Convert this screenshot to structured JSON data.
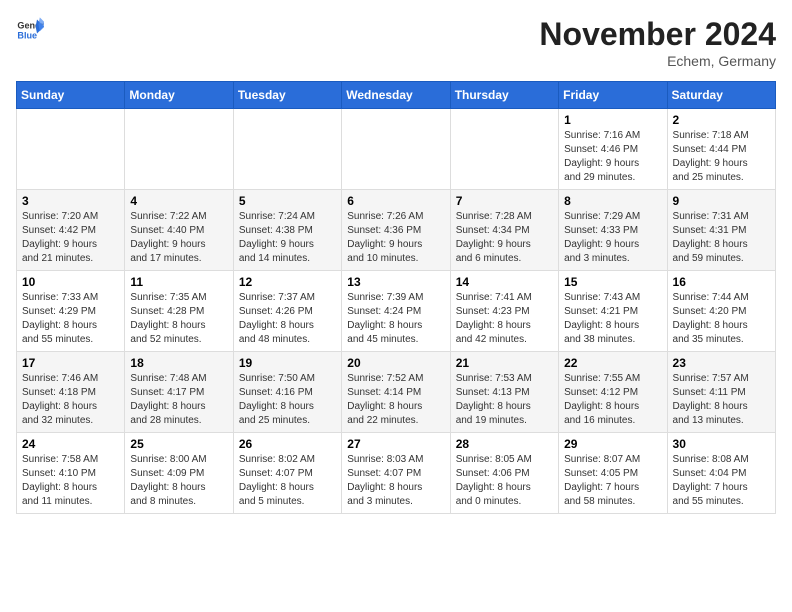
{
  "header": {
    "logo_general": "General",
    "logo_blue": "Blue",
    "month_title": "November 2024",
    "location": "Echem, Germany"
  },
  "weekdays": [
    "Sunday",
    "Monday",
    "Tuesday",
    "Wednesday",
    "Thursday",
    "Friday",
    "Saturday"
  ],
  "weeks": [
    [
      {
        "day": "",
        "info": ""
      },
      {
        "day": "",
        "info": ""
      },
      {
        "day": "",
        "info": ""
      },
      {
        "day": "",
        "info": ""
      },
      {
        "day": "",
        "info": ""
      },
      {
        "day": "1",
        "info": "Sunrise: 7:16 AM\nSunset: 4:46 PM\nDaylight: 9 hours\nand 29 minutes."
      },
      {
        "day": "2",
        "info": "Sunrise: 7:18 AM\nSunset: 4:44 PM\nDaylight: 9 hours\nand 25 minutes."
      }
    ],
    [
      {
        "day": "3",
        "info": "Sunrise: 7:20 AM\nSunset: 4:42 PM\nDaylight: 9 hours\nand 21 minutes."
      },
      {
        "day": "4",
        "info": "Sunrise: 7:22 AM\nSunset: 4:40 PM\nDaylight: 9 hours\nand 17 minutes."
      },
      {
        "day": "5",
        "info": "Sunrise: 7:24 AM\nSunset: 4:38 PM\nDaylight: 9 hours\nand 14 minutes."
      },
      {
        "day": "6",
        "info": "Sunrise: 7:26 AM\nSunset: 4:36 PM\nDaylight: 9 hours\nand 10 minutes."
      },
      {
        "day": "7",
        "info": "Sunrise: 7:28 AM\nSunset: 4:34 PM\nDaylight: 9 hours\nand 6 minutes."
      },
      {
        "day": "8",
        "info": "Sunrise: 7:29 AM\nSunset: 4:33 PM\nDaylight: 9 hours\nand 3 minutes."
      },
      {
        "day": "9",
        "info": "Sunrise: 7:31 AM\nSunset: 4:31 PM\nDaylight: 8 hours\nand 59 minutes."
      }
    ],
    [
      {
        "day": "10",
        "info": "Sunrise: 7:33 AM\nSunset: 4:29 PM\nDaylight: 8 hours\nand 55 minutes."
      },
      {
        "day": "11",
        "info": "Sunrise: 7:35 AM\nSunset: 4:28 PM\nDaylight: 8 hours\nand 52 minutes."
      },
      {
        "day": "12",
        "info": "Sunrise: 7:37 AM\nSunset: 4:26 PM\nDaylight: 8 hours\nand 48 minutes."
      },
      {
        "day": "13",
        "info": "Sunrise: 7:39 AM\nSunset: 4:24 PM\nDaylight: 8 hours\nand 45 minutes."
      },
      {
        "day": "14",
        "info": "Sunrise: 7:41 AM\nSunset: 4:23 PM\nDaylight: 8 hours\nand 42 minutes."
      },
      {
        "day": "15",
        "info": "Sunrise: 7:43 AM\nSunset: 4:21 PM\nDaylight: 8 hours\nand 38 minutes."
      },
      {
        "day": "16",
        "info": "Sunrise: 7:44 AM\nSunset: 4:20 PM\nDaylight: 8 hours\nand 35 minutes."
      }
    ],
    [
      {
        "day": "17",
        "info": "Sunrise: 7:46 AM\nSunset: 4:18 PM\nDaylight: 8 hours\nand 32 minutes."
      },
      {
        "day": "18",
        "info": "Sunrise: 7:48 AM\nSunset: 4:17 PM\nDaylight: 8 hours\nand 28 minutes."
      },
      {
        "day": "19",
        "info": "Sunrise: 7:50 AM\nSunset: 4:16 PM\nDaylight: 8 hours\nand 25 minutes."
      },
      {
        "day": "20",
        "info": "Sunrise: 7:52 AM\nSunset: 4:14 PM\nDaylight: 8 hours\nand 22 minutes."
      },
      {
        "day": "21",
        "info": "Sunrise: 7:53 AM\nSunset: 4:13 PM\nDaylight: 8 hours\nand 19 minutes."
      },
      {
        "day": "22",
        "info": "Sunrise: 7:55 AM\nSunset: 4:12 PM\nDaylight: 8 hours\nand 16 minutes."
      },
      {
        "day": "23",
        "info": "Sunrise: 7:57 AM\nSunset: 4:11 PM\nDaylight: 8 hours\nand 13 minutes."
      }
    ],
    [
      {
        "day": "24",
        "info": "Sunrise: 7:58 AM\nSunset: 4:10 PM\nDaylight: 8 hours\nand 11 minutes."
      },
      {
        "day": "25",
        "info": "Sunrise: 8:00 AM\nSunset: 4:09 PM\nDaylight: 8 hours\nand 8 minutes."
      },
      {
        "day": "26",
        "info": "Sunrise: 8:02 AM\nSunset: 4:07 PM\nDaylight: 8 hours\nand 5 minutes."
      },
      {
        "day": "27",
        "info": "Sunrise: 8:03 AM\nSunset: 4:07 PM\nDaylight: 8 hours\nand 3 minutes."
      },
      {
        "day": "28",
        "info": "Sunrise: 8:05 AM\nSunset: 4:06 PM\nDaylight: 8 hours\nand 0 minutes."
      },
      {
        "day": "29",
        "info": "Sunrise: 8:07 AM\nSunset: 4:05 PM\nDaylight: 7 hours\nand 58 minutes."
      },
      {
        "day": "30",
        "info": "Sunrise: 8:08 AM\nSunset: 4:04 PM\nDaylight: 7 hours\nand 55 minutes."
      }
    ]
  ]
}
